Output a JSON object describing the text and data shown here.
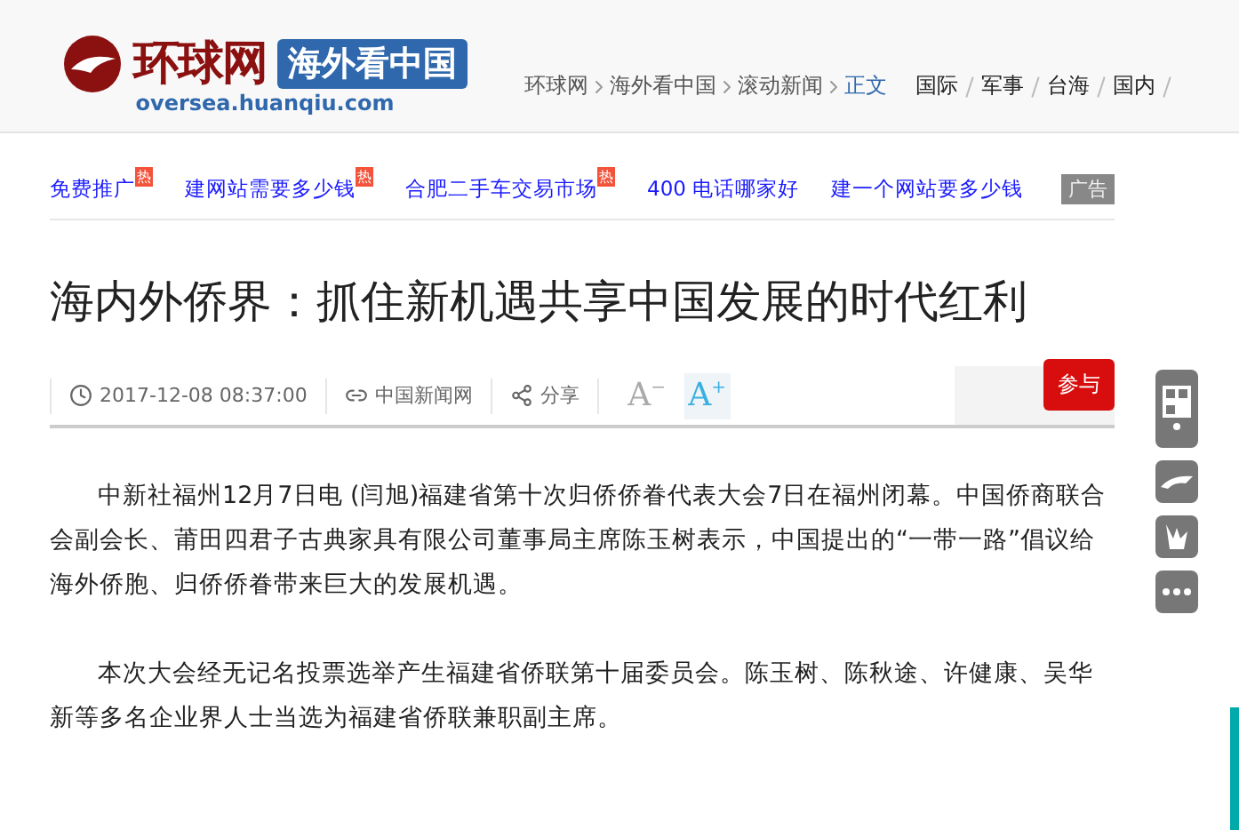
{
  "header": {
    "logo": {
      "name": "环球网",
      "channel": "海外看中国",
      "url": "oversea.huanqiu.com"
    },
    "breadcrumb": [
      {
        "label": "环球网",
        "current": false
      },
      {
        "label": "海外看中国",
        "current": false
      },
      {
        "label": "滚动新闻",
        "current": false
      },
      {
        "label": "正文",
        "current": true
      }
    ],
    "nav": [
      "国际",
      "军事",
      "台海",
      "国内"
    ]
  },
  "ads": {
    "links": [
      {
        "label": "免费推广",
        "hot_badge": "热"
      },
      {
        "label": "建网站需要多少钱",
        "hot_badge": "热"
      },
      {
        "label": "合肥二手车交易市场",
        "hot_badge": "热"
      },
      {
        "label": "400 电话哪家好"
      },
      {
        "label": "建一个网站要多少钱"
      }
    ],
    "badge": "广告"
  },
  "article": {
    "title": "海内外侨界：抓住新机遇共享中国发展的时代红利",
    "toolbar": {
      "time": "2017-12-08 08:37:00",
      "source": "中国新闻网",
      "share": "分享",
      "font_buttons": [
        {
          "label": "A",
          "sign": "−",
          "selected": false
        },
        {
          "label": "A",
          "sign": "+",
          "selected": true
        }
      ],
      "join": "参与"
    },
    "paragraphs": [
      "中新社福州12月7日电 (闫旭)福建省第十次归侨侨眷代表大会7日在福州闭幕。中国侨商联合会副会长、莆田四君子古典家具有限公司董事局主席陈玉树表示，中国提出的“一带一路”倡议给海外侨胞、归侨侨眷带来巨大的发展机遇。",
      "本次大会经无记名投票选举产生福建省侨联第十届委员会。陈玉树、陈秋途、许健康、吴华新等多名企业界人士当选为福建省侨联兼职副主席。"
    ]
  }
}
